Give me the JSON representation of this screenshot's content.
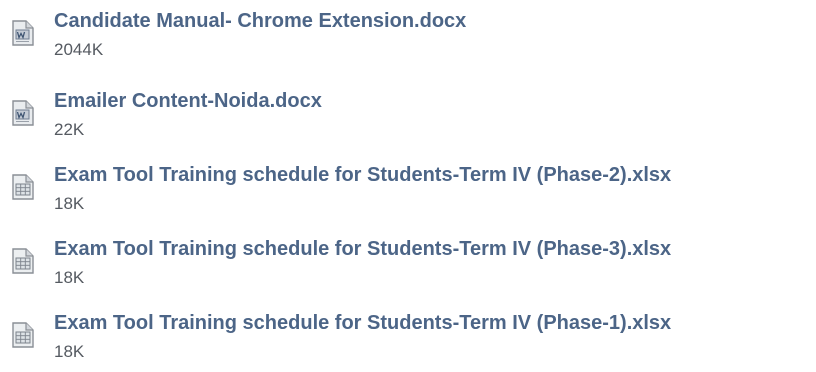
{
  "files": [
    {
      "name": "Candidate Manual- Chrome Extension.docx",
      "size": "2044K",
      "icon": "word-document-icon"
    },
    {
      "name": "Emailer Content-Noida.docx",
      "size": "22K",
      "icon": "word-document-icon"
    },
    {
      "name": "Exam Tool Training schedule for Students-Term IV (Phase-2).xlsx",
      "size": "18K",
      "icon": "spreadsheet-icon"
    },
    {
      "name": "Exam Tool Training schedule for Students-Term IV (Phase-3).xlsx",
      "size": "18K",
      "icon": "spreadsheet-icon"
    },
    {
      "name": "Exam Tool Training schedule for Students-Term IV (Phase-1).xlsx",
      "size": "18K",
      "icon": "spreadsheet-icon"
    }
  ],
  "colors": {
    "link": "#4c6587",
    "size_text": "#555a61"
  }
}
